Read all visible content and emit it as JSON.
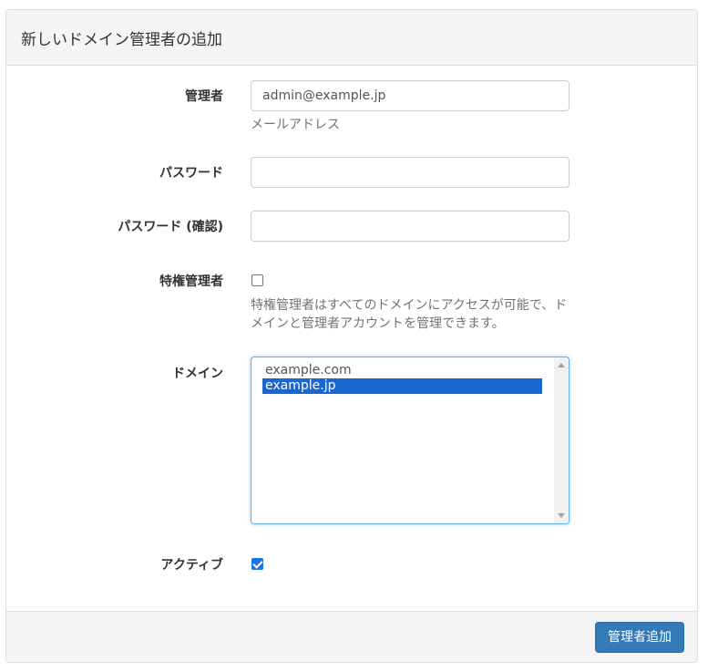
{
  "panel": {
    "title": "新しいドメイン管理者の追加"
  },
  "form": {
    "admin": {
      "label": "管理者",
      "value": "admin@example.jp",
      "help": "メールアドレス"
    },
    "password": {
      "label": "パスワード",
      "value": ""
    },
    "password_confirm": {
      "label": "パスワード (確認)",
      "value": ""
    },
    "super_admin": {
      "label": "特権管理者",
      "checked": false,
      "help": "特権管理者はすべてのドメインにアクセスが可能で、ドメインと管理者アカウントを管理できます。"
    },
    "domains": {
      "label": "ドメイン",
      "options": [
        {
          "label": "example.com",
          "selected": false
        },
        {
          "label": "example.jp",
          "selected": true
        }
      ]
    },
    "active": {
      "label": "アクティブ",
      "checked": true
    }
  },
  "footer": {
    "submit_label": "管理者追加"
  },
  "colors": {
    "primary_button": "#337ab7",
    "selected_option": "#1a67d2",
    "checkbox_checked": "#1a73e8"
  }
}
